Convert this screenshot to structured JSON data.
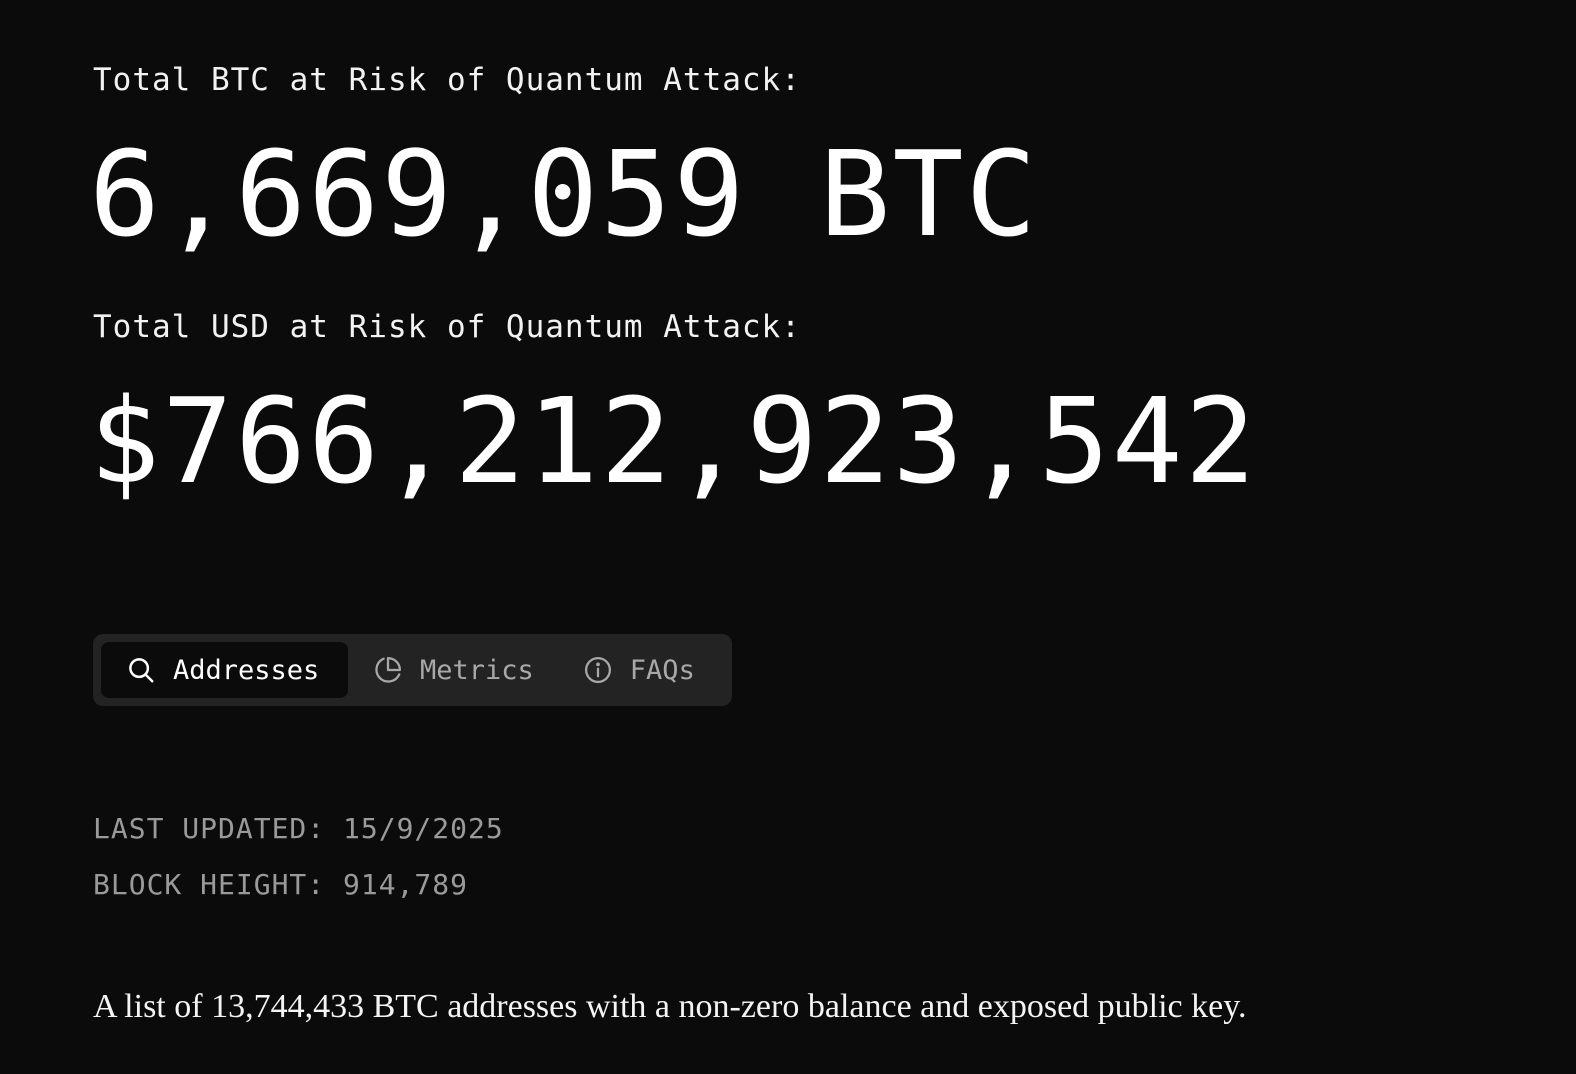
{
  "btc_label": "Total BTC at Risk of Quantum Attack:",
  "btc_value": "6,669,059 BTC",
  "usd_label": "Total USD at Risk of Quantum Attack:",
  "usd_value": "$766,212,923,542",
  "tabs": [
    {
      "label": "Addresses",
      "icon": "search-icon",
      "active": true
    },
    {
      "label": "Metrics",
      "icon": "pie-chart-icon",
      "active": false
    },
    {
      "label": "FAQs",
      "icon": "info-icon",
      "active": false
    }
  ],
  "last_updated": "LAST UPDATED: 15/9/2025",
  "block_height": "BLOCK HEIGHT: 914,789",
  "description": "A list of 13,744,433 BTC addresses with a non-zero balance and exposed public key.",
  "colors": {
    "background": "#0b0b0b",
    "tab_bar": "#232323",
    "active_tab": "#0b0b0b",
    "muted_text": "#9a9a9a"
  }
}
